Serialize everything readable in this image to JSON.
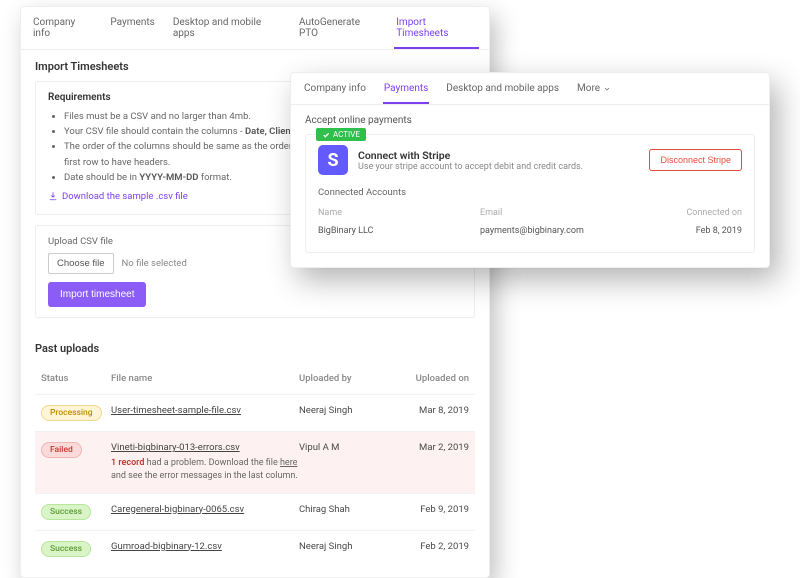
{
  "tabs": {
    "company": "Company info",
    "payments": "Payments",
    "apps": "Desktop and mobile apps",
    "pto": "AutoGenerate PTO",
    "import": "Import Timesheets"
  },
  "import": {
    "heading": "Import Timesheets",
    "requirements_label": "Requirements",
    "req1": "Files must be a CSV and no larger than 4mb.",
    "req2_pre": "Your CSV file should contain the columns - ",
    "req2_bold": "Date, Client, Pr",
    "req3": "The order of the columns should be same as the order in which they are written above. Expect first row to have headers.",
    "req4_pre": "Date should be in ",
    "req4_bold": "YYYY-MM-DD",
    "req4_post": " format.",
    "download_link": "Download the sample .csv file",
    "upload_label": "Upload CSV file",
    "choose_file": "Choose file",
    "no_file": "No file selected",
    "import_btn": "Import timesheet"
  },
  "past": {
    "heading": "Past uploads",
    "col_status": "Status",
    "col_file": "File name",
    "col_by": "Uploaded by",
    "col_on": "Uploaded on",
    "rows": [
      {
        "status": "Processing",
        "status_class": "processing",
        "file": "User-timesheet-sample-file.csv",
        "by": "Neeraj Singh",
        "on": "Mar 8, 2019"
      },
      {
        "status": "Failed",
        "status_class": "failed",
        "file": "Vineti-bigbinary-013-errors.csv",
        "by": "Vipul A M",
        "on": "Mar 2, 2019",
        "err_count": "1 record",
        "err_mid": " had a problem. Download the file ",
        "err_here": "here",
        "err_post": " and see the error messages in the last column."
      },
      {
        "status": "Success",
        "status_class": "success",
        "file": "Caregeneral-bigbinary-0065.csv",
        "by": "Chirag Shah",
        "on": "Feb 9, 2019"
      },
      {
        "status": "Success",
        "status_class": "success",
        "file": "Gumroad-bigbinary-12.csv",
        "by": "Neeraj Singh",
        "on": "Feb 2, 2019"
      }
    ]
  },
  "overlay": {
    "tabs": {
      "company": "Company info",
      "payments": "Payments",
      "apps": "Desktop and mobile apps",
      "more": "More"
    },
    "accept": "Accept online payments",
    "active_badge": "ACTIVE",
    "stripe_title": "Connect with Stripe",
    "stripe_sub": "Use your stripe account to accept debit and credit cards.",
    "disconnect": "Disconnect Stripe",
    "connected_accounts": "Connected Accounts",
    "col_name": "Name",
    "col_email": "Email",
    "col_conn": "Connected on",
    "acc_name": "BigBinary LLC",
    "acc_email": "payments@bigbinary.com",
    "acc_date": "Feb 8, 2019"
  }
}
